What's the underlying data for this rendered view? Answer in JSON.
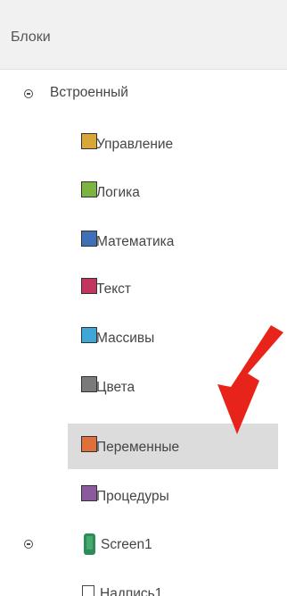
{
  "panel": {
    "title": "Блоки"
  },
  "tree": {
    "builtin": {
      "label": "Встроенный",
      "items": [
        {
          "label": "Управление",
          "color": "#d9a63a",
          "icon": "control-block-icon"
        },
        {
          "label": "Логика",
          "color": "#7cb342",
          "icon": "logic-block-icon"
        },
        {
          "label": "Математика",
          "color": "#3f6fb8",
          "icon": "math-block-icon"
        },
        {
          "label": "Текст",
          "color": "#c2355c",
          "icon": "text-block-icon"
        },
        {
          "label": "Массивы",
          "color": "#3fa7d6",
          "icon": "lists-block-icon"
        },
        {
          "label": "Цвета",
          "color": "#7a7a7a",
          "icon": "colors-block-icon"
        },
        {
          "label": "Переменные",
          "color": "#e0703a",
          "icon": "variables-block-icon",
          "selected": true
        },
        {
          "label": "Процедуры",
          "color": "#8a5a9c",
          "icon": "procedures-block-icon"
        }
      ]
    },
    "screen": {
      "label": "Screen1",
      "icon": "phone-icon",
      "color": "#2e8b57"
    },
    "next_item": {
      "label": "Надпись1"
    }
  },
  "annotation": {
    "arrow_color": "#e8231a",
    "icon": "red-arrow-icon"
  }
}
